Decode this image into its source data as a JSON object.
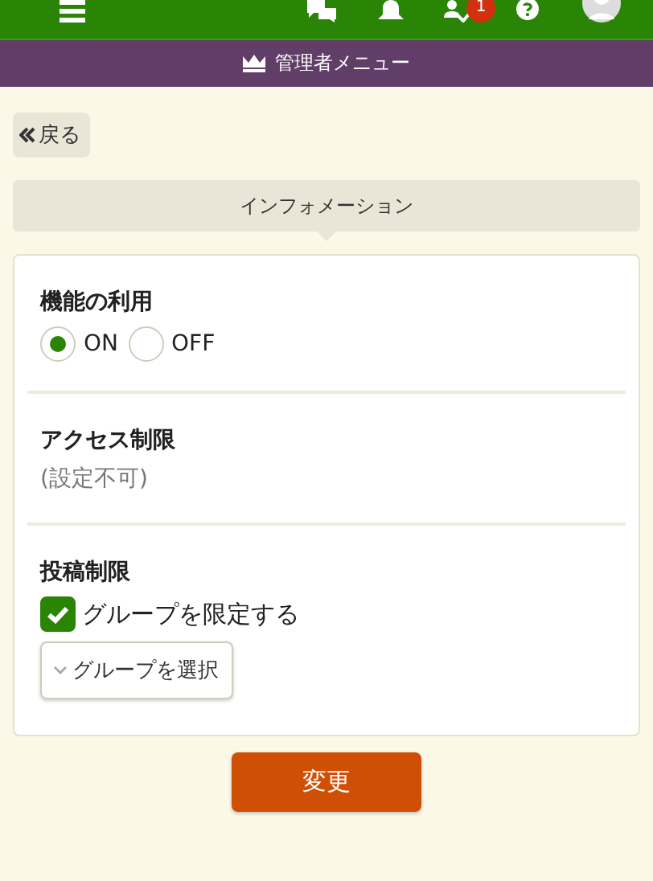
{
  "top_bar": {
    "notification_badge": "1"
  },
  "admin_bar": {
    "title": "管理者メニュー"
  },
  "back_button": {
    "label": "戻る"
  },
  "section_tab": {
    "label": "インフォメーション"
  },
  "sections": [
    {
      "kind": "radio",
      "title": "機能の利用",
      "options": [
        {
          "label": "ON",
          "selected": true
        },
        {
          "label": "OFF",
          "selected": false
        }
      ]
    },
    {
      "kind": "note",
      "title": "アクセス制限",
      "text": "(設定不可)"
    },
    {
      "kind": "checkbox",
      "title": "投稿制限",
      "checkbox": {
        "label": "グループを限定する",
        "checked": true
      },
      "select_button": "グループを選択"
    }
  ],
  "submit_button": {
    "label": "変更"
  }
}
